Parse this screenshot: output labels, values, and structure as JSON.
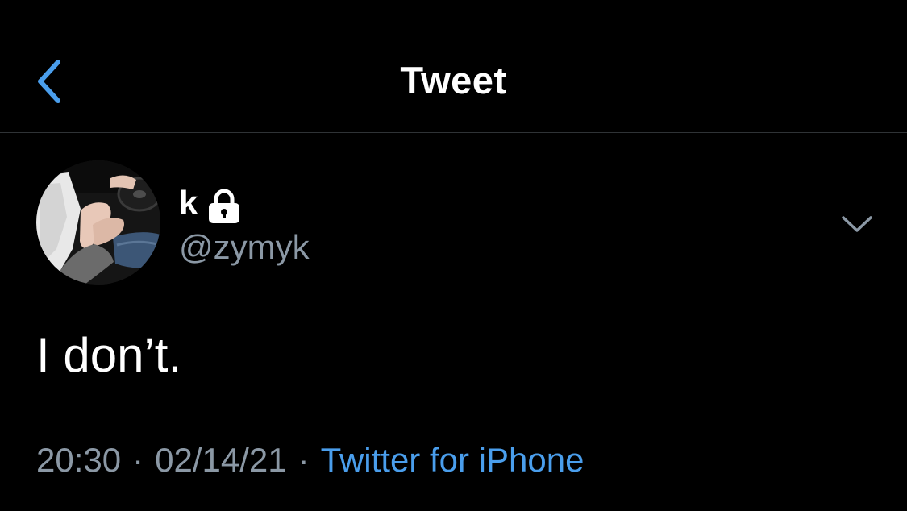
{
  "nav": {
    "title": "Tweet",
    "back_icon": "chevron-left-icon"
  },
  "author": {
    "display_name": "k",
    "protected_icon": "lock-icon",
    "handle": "@zymyk",
    "avatar_icon": "avatar"
  },
  "tweet": {
    "text": "I don’t.",
    "time": "20:30",
    "separator": "·",
    "date": "02/14/21",
    "source": "Twitter for iPhone",
    "more_icon": "chevron-down-icon"
  },
  "colors": {
    "background": "#000000",
    "accent": "#4a9eec",
    "muted": "#8b98a5",
    "divider": "#2f3336"
  }
}
